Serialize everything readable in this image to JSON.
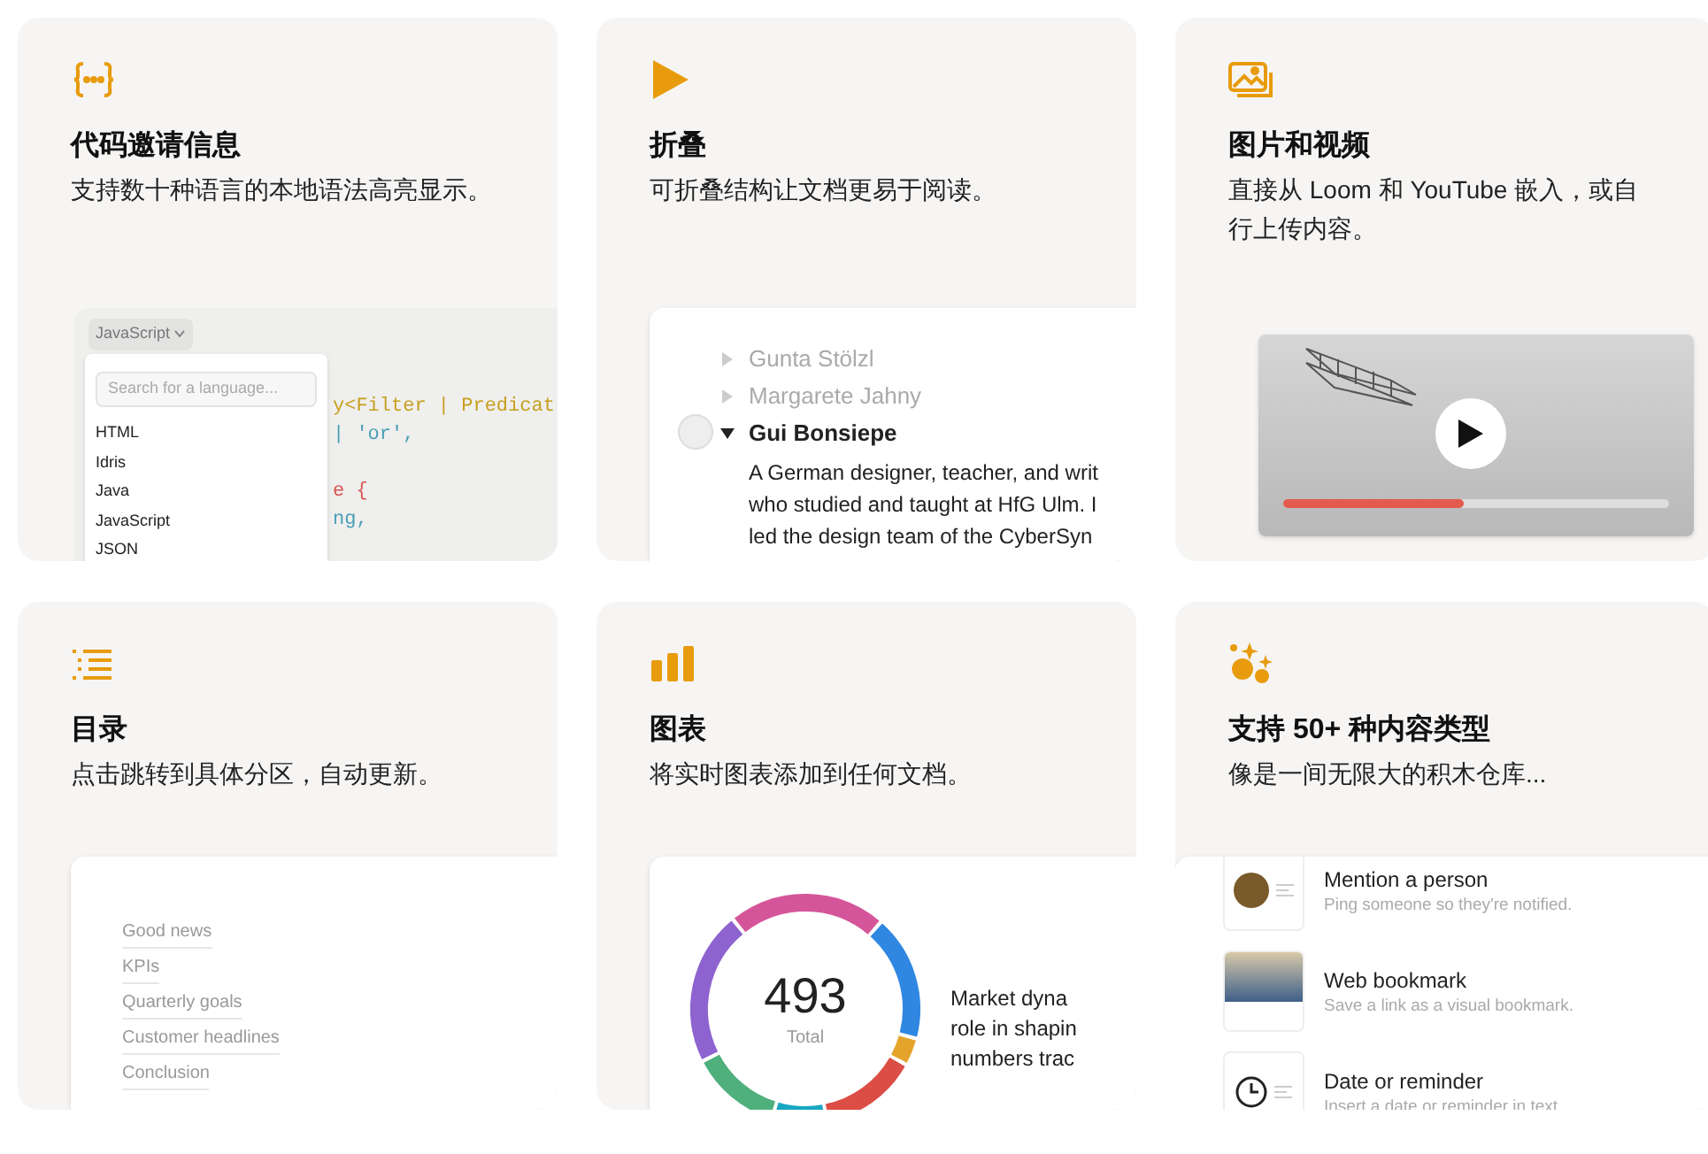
{
  "cards": [
    {
      "kind": "code",
      "title": "代码邀请信息",
      "description": "支持数十种语言的本地语法高亮显示。",
      "preview": {
        "language": "JavaScript",
        "search_placeholder": "Search for a language...",
        "languages": [
          "HTML",
          "Idris",
          "Java",
          "JavaScript",
          "JSON"
        ],
        "code_lines": [
          {
            "text": "y<Filter | Predicat",
            "color": "#c7a020"
          },
          {
            "text": "| 'or',",
            "color": "#4a9fb5"
          },
          {
            "text": "e {",
            "color": "#d9534f"
          },
          {
            "text": "ng,",
            "color": "#4a9fb5"
          }
        ]
      }
    },
    {
      "kind": "toggle",
      "title": "折叠",
      "description": "可折叠结构让文档更易于阅读。",
      "preview": {
        "items": [
          {
            "name": "Gunta Stölzl",
            "expanded": false
          },
          {
            "name": "Margarete Jahny",
            "expanded": false
          },
          {
            "name": "Gui Bonsiepe",
            "expanded": true,
            "body": [
              "A German designer, teacher, and writ",
              "who studied and taught at HfG Ulm. I",
              "led the design team of the CyberSyn"
            ]
          }
        ]
      }
    },
    {
      "kind": "video",
      "title": "图片和视频",
      "description": "直接从 Loom 和 YouTube 嵌入，或自行上传内容。",
      "preview": {
        "level": 0.47
      }
    },
    {
      "kind": "toc",
      "title": "目录",
      "description": "点击跳转到具体分区，自动更新。",
      "preview": {
        "entries": [
          "Good news",
          "KPIs",
          "Quarterly goals",
          "Customer headlines",
          "Conclusion"
        ]
      }
    },
    {
      "kind": "chart",
      "title": "图表",
      "description": "将实时图表添加到任何文档。",
      "preview": {
        "total": "493",
        "total_label": "Total",
        "text_lines": [
          "Market dyna",
          "role in shapin",
          "numbers trac"
        ]
      }
    },
    {
      "kind": "blocks",
      "title": "支持 50+ 种内容类型",
      "description": "像是一间无限大的积木仓库...",
      "preview": {
        "items": [
          {
            "kind": "person",
            "title": "Mention a person",
            "subtitle": "Ping someone so they're notified."
          },
          {
            "kind": "bookmark",
            "title": "Web bookmark",
            "subtitle": "Save a link as a visual bookmark."
          },
          {
            "kind": "date",
            "title": "Date or reminder",
            "subtitle": "Insert a date or reminder in text"
          }
        ]
      }
    }
  ]
}
